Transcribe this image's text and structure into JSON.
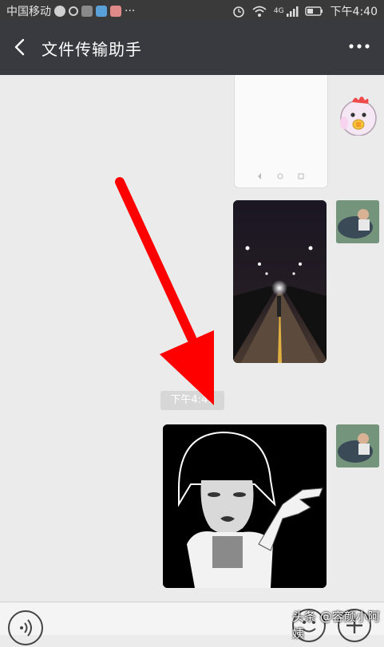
{
  "status_bar": {
    "carrier": "中国移动",
    "time": "下午4:40",
    "network_label": "4G",
    "more_glyph": "···"
  },
  "header": {
    "title": "文件传输助手"
  },
  "chat": {
    "timestamp": "下午4:40"
  },
  "watermark": {
    "text": "头条 @容颜小阿姨"
  },
  "colors": {
    "title_bar": "#393a3f",
    "status_bar": "#3a3a3a",
    "chat_bg": "#ebebeb",
    "arrow": "#ff0000"
  },
  "icons": {
    "back": "chevron-left-icon",
    "more": "ellipsis-icon",
    "voice": "voice-icon",
    "emoji": "emoji-icon",
    "plus": "plus-icon"
  }
}
